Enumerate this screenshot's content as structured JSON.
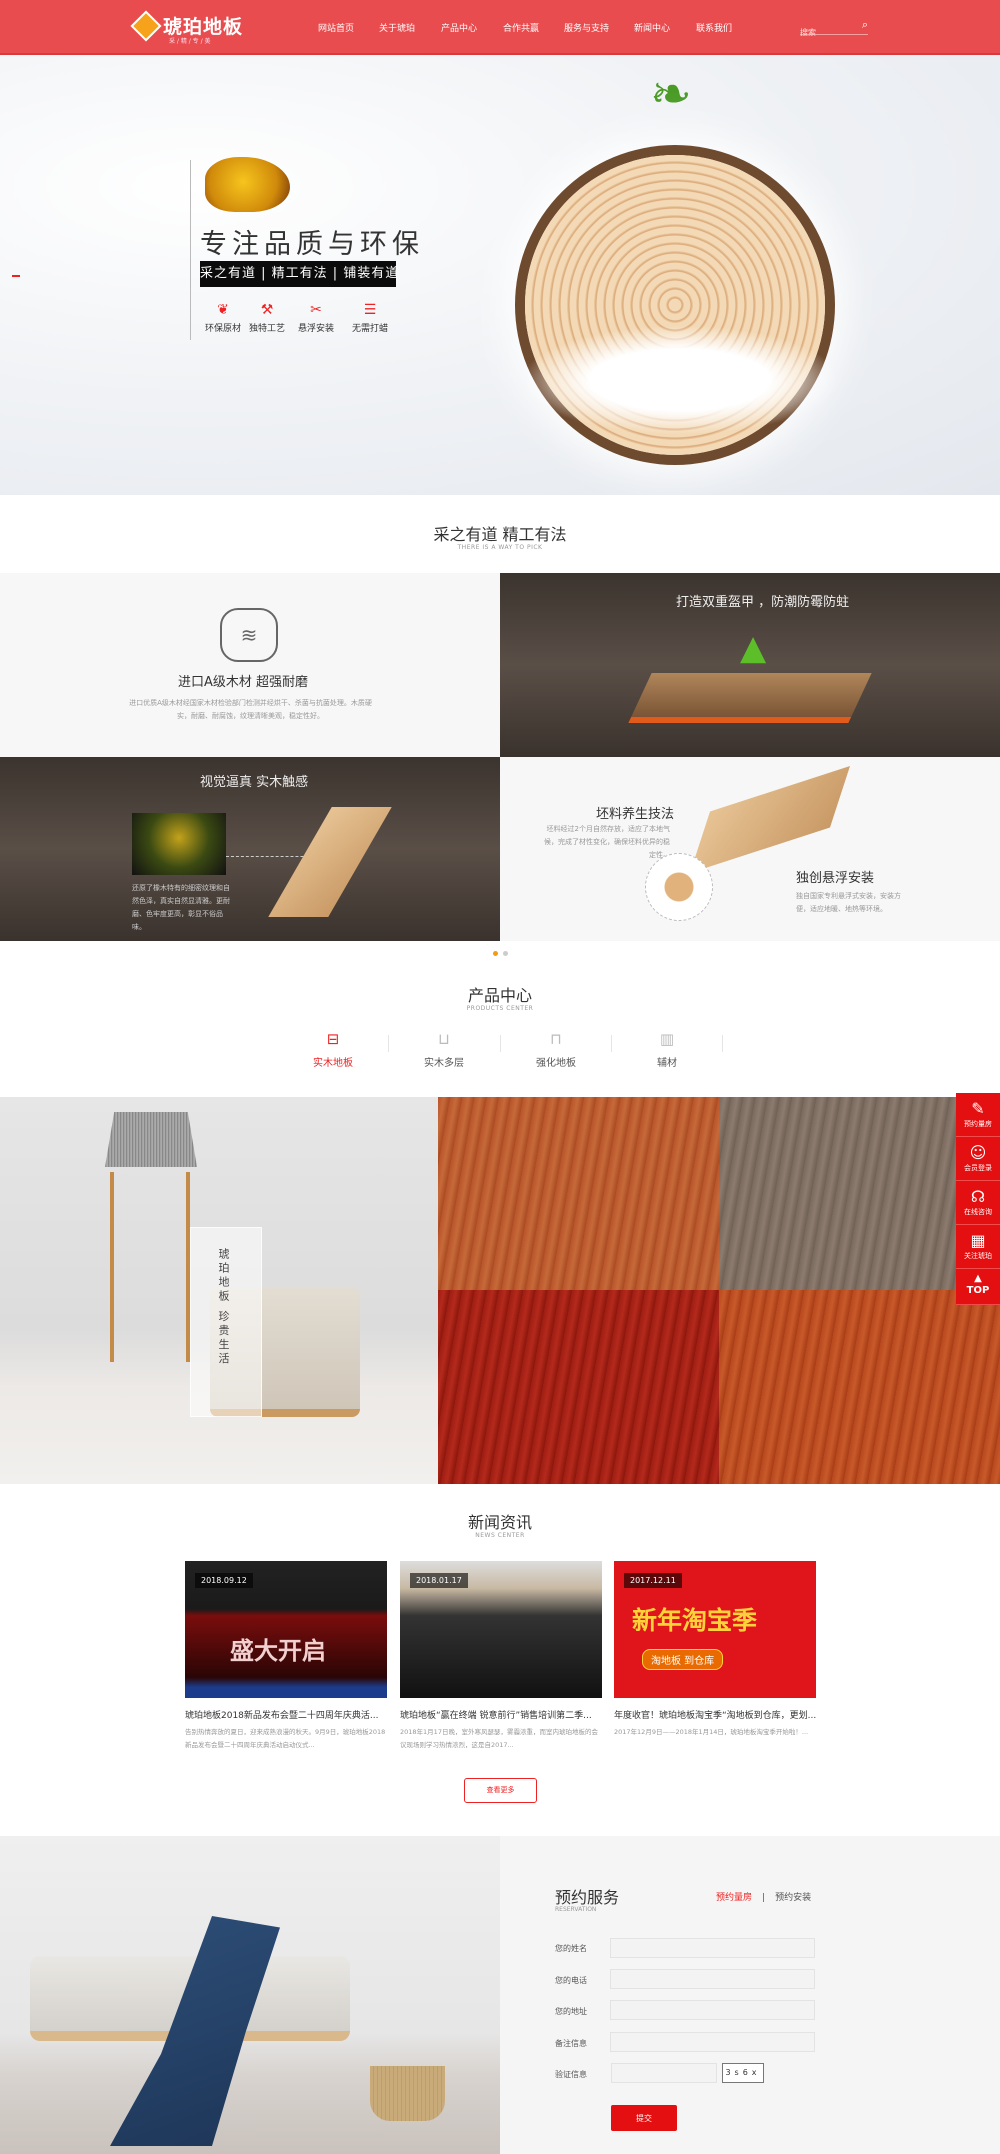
{
  "header": {
    "logo_text": "琥珀地板",
    "logo_sub": "采 / 精 / 专 / 美",
    "nav": [
      "网站首页",
      "关于琥珀",
      "产品中心",
      "合作共赢",
      "服务与支持",
      "新闻中心",
      "联系我们"
    ],
    "search_placeholder": "搜索",
    "brand_color": "#e84c4f"
  },
  "hero": {
    "title": "专注品质与环保",
    "tagline": "采之有道 | 精工有法 | 铺装有道",
    "features": [
      {
        "icon": "leaf-icon",
        "label": "环保原材"
      },
      {
        "icon": "tools-icon",
        "label": "独特工艺"
      },
      {
        "icon": "cross-tools-icon",
        "label": "悬浮安装"
      },
      {
        "icon": "layers-icon",
        "label": "无需打蜡"
      }
    ]
  },
  "craft": {
    "title": "采之有道 精工有法",
    "subtitle": "THERE IS A WAY TO PICK",
    "panel1": {
      "title": "进口A级木材 超强耐磨",
      "desc": "进口优质A级木材经国家木材检验部门检测并经烘干、杀菌与抗菌处理。木质硬实，耐磨、耐腐蚀，纹理清晰美观，稳定性好。"
    },
    "panel2": {
      "title": "打造双重盔甲 ，防潮防霉防蛀"
    },
    "panel3": {
      "title": "视觉逼真 实木触感",
      "desc": "还原了橡木特有的细密纹理和自然色泽，真实自然显清雅。更耐磨、色牢度更高，彰显不俗品味。"
    },
    "panel4": {
      "title1": "坯料养生技法",
      "desc1": "坯料经过2个月自然存放，适应了本地气候，完成了材性变化，确保坯料优异的稳定性。",
      "title2": "独创悬浮安装",
      "desc2": "独自国家专利悬浮式安装，安装方便，适应地暖、地热等环境。"
    },
    "slide_active": 1,
    "slide_count": 2
  },
  "products": {
    "title": "产品中心",
    "subtitle": "PRODUCTS CENTER",
    "tabs": [
      {
        "icon": "bed-icon",
        "label": "实木地板",
        "active": true
      },
      {
        "icon": "sofa-icon",
        "label": "实木多层"
      },
      {
        "icon": "chair-icon",
        "label": "强化地板"
      },
      {
        "icon": "crib-icon",
        "label": "辅材"
      }
    ],
    "banner_text": "琥珀地板 珍贵生活"
  },
  "sidebar": [
    {
      "icon": "measure-icon",
      "label": "预约量房"
    },
    {
      "icon": "user-icon",
      "label": "会员登录"
    },
    {
      "icon": "headset-icon",
      "label": "在线咨询"
    },
    {
      "icon": "qrcode-icon",
      "label": "关注琥珀"
    },
    {
      "icon": "arrow-up-icon",
      "label": "TOP"
    }
  ],
  "news": {
    "title": "新闻资讯",
    "subtitle": "NEWS CENTER",
    "items": [
      {
        "date": "2018.09.12",
        "title": "琥珀地板2018新品发布会暨二十四周年庆典活...",
        "desc": "告别热情奔放的夏日，迎来成熟浪漫的秋天。9月9日，琥珀地板2018新品发布会暨二十四周年庆典活动启动仪式...",
        "image_text": "盛大开启"
      },
      {
        "date": "2018.01.17",
        "title": "琥珀地板“赢在终端 锐意前行”销售培训第二季...",
        "desc": "2018年1月17日晚，室外寒风瑟瑟，雾霾浓重，而室内琥珀地板的会议现场则学习热情浓烈，这是自2017..."
      },
      {
        "date": "2017.12.11",
        "title": "年度收官！琥珀地板淘宝季“淘地板到仓库，更划...",
        "desc": "2017年12月9日——2018年1月14日，琥珀地板淘宝季开始啦！...",
        "image_text": "新年淘宝季",
        "image_sub": "淘地板 到仓库"
      }
    ],
    "more_label": "查看更多"
  },
  "reservation": {
    "title": "预约服务",
    "subtitle": "RESERVATION",
    "tabs": [
      "预约量房",
      "预约安装"
    ],
    "fields": [
      "您的姓名",
      "您的电话",
      "您的地址",
      "备注信息",
      "验证信息"
    ],
    "captcha": "3s6x",
    "submit": "提交"
  }
}
